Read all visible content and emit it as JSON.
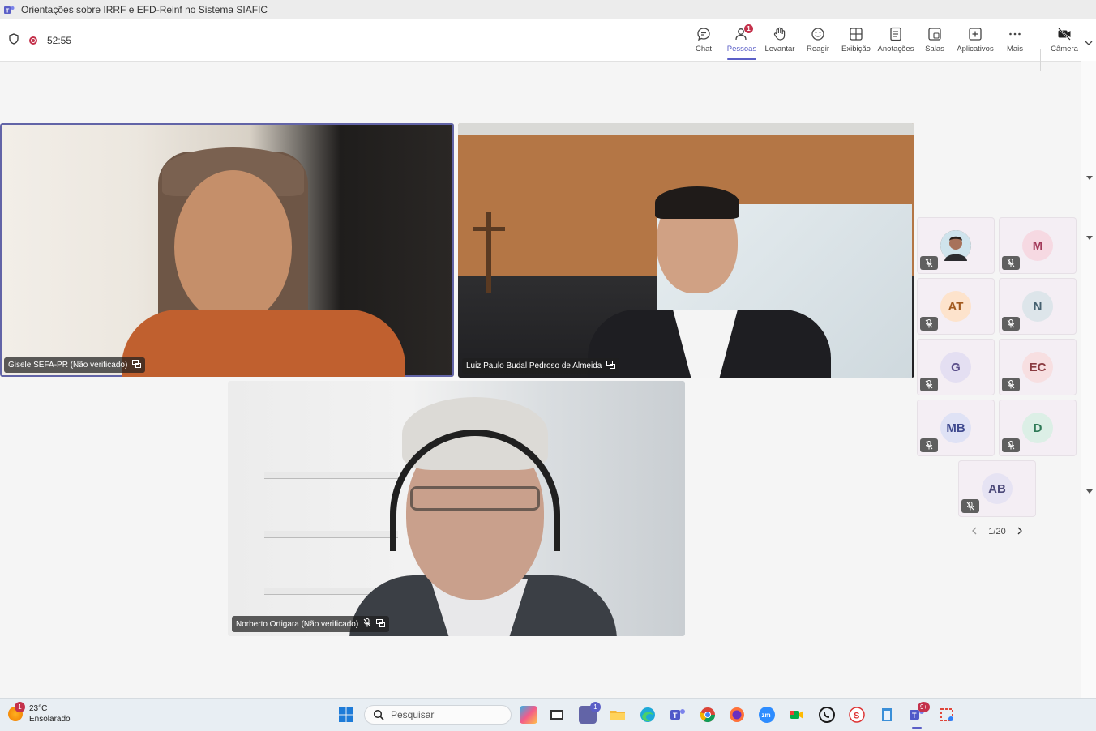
{
  "window": {
    "title": "Orientações sobre IRRF e EFD-Reinf no Sistema SIAFIC"
  },
  "meeting": {
    "timer": "52:55"
  },
  "toolbar": {
    "chat": "Chat",
    "people": "Pessoas",
    "people_badge": "1",
    "raise": "Levantar",
    "react": "Reagir",
    "view": "Exibição",
    "notes": "Anotações",
    "rooms": "Salas",
    "apps": "Aplicativos",
    "more": "Mais",
    "camera": "Câmera"
  },
  "videos": [
    {
      "name": "Gisele SEFA-PR (Não verificado)"
    },
    {
      "name": "Luiz Paulo Budal Pedroso de Almeida"
    },
    {
      "name": "Norberto Ortigara (Não verificado)"
    }
  ],
  "participants": [
    {
      "initials": "",
      "photo": true
    },
    {
      "initials": "M",
      "color": "#f6d9e2",
      "text_color": "#a33a5a"
    },
    {
      "initials": "AT",
      "color": "#fde3cc",
      "text_color": "#a25a1e"
    },
    {
      "initials": "N",
      "color": "#dde5ea",
      "text_color": "#45606f"
    },
    {
      "initials": "G",
      "color": "#e4dff2",
      "text_color": "#5b4f8a"
    },
    {
      "initials": "EC",
      "color": "#f7dfe1",
      "text_color": "#8a3a40"
    },
    {
      "initials": "MB",
      "color": "#dfe2f5",
      "text_color": "#3f4a8f"
    },
    {
      "initials": "D",
      "color": "#dcefe6",
      "text_color": "#2f7a57"
    },
    {
      "initials": "AB",
      "color": "#e6e3f3",
      "text_color": "#4d4a7a"
    }
  ],
  "pager": {
    "label": "1/20"
  },
  "taskbar": {
    "weather_temp": "23°C",
    "weather_desc": "Ensolarado",
    "weather_badge": "1",
    "search_placeholder": "Pesquisar",
    "chat_badge": "1",
    "teams_badge": "9+"
  },
  "colors": {
    "accent": "#5b5fc7",
    "record": "#c4314b"
  }
}
